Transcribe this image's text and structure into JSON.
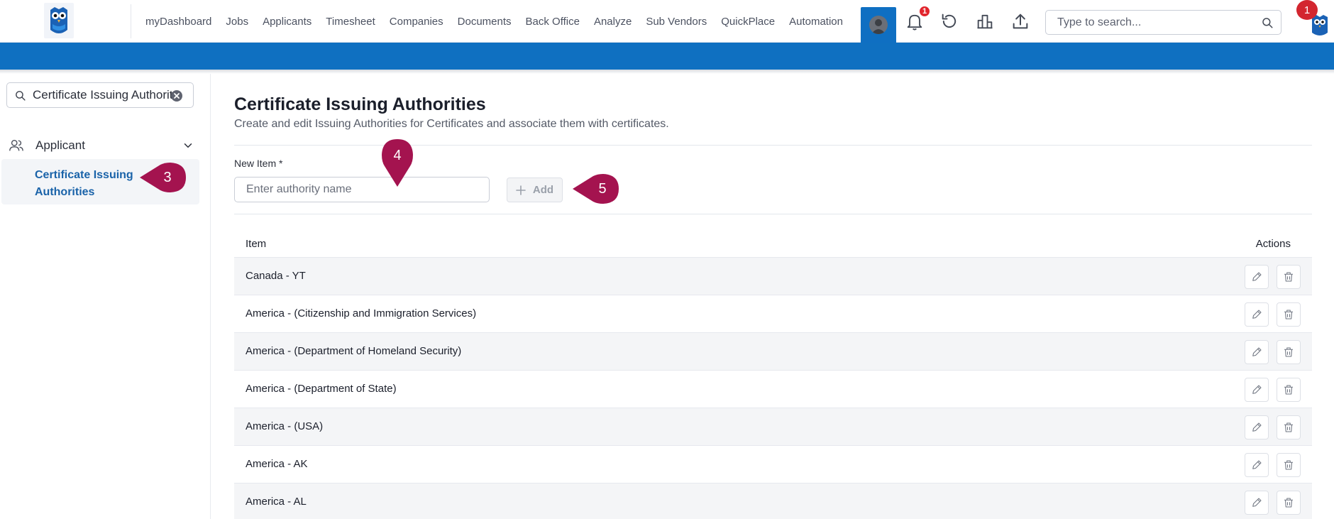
{
  "nav": {
    "items": [
      "myDashboard",
      "Jobs",
      "Applicants",
      "Timesheet",
      "Companies",
      "Documents",
      "Back Office",
      "Analyze",
      "Sub Vendors",
      "QuickPlace",
      "Automation"
    ]
  },
  "header": {
    "notification_count": "1",
    "search_placeholder": "Type to search...",
    "tour_step": "1"
  },
  "sidebar": {
    "search_value": "Certificate Issuing Authorities",
    "group_label": "Applicant",
    "item_label": "Certificate Issuing Authorities",
    "tour_step": "3"
  },
  "main": {
    "title": "Certificate Issuing Authorities",
    "subtitle": "Create and edit Issuing Authorities for Certificates and associate them with certificates.",
    "new_item_label": "New Item *",
    "new_item_placeholder": "Enter authority name",
    "add_label": "Add",
    "input_tour_step": "4",
    "add_tour_step": "5"
  },
  "table": {
    "columns": [
      "Item",
      "Actions"
    ],
    "rows": [
      "Canada - YT",
      "America - (Citizenship and Immigration Services)",
      "America - (Department of Homeland Security)",
      "America - (Department of State)",
      "America - (USA)",
      "America - AK",
      "America - AL"
    ]
  },
  "colors": {
    "brand_blue": "#0f70c1",
    "link_blue": "#1a63a9",
    "marker": "#a4134f",
    "badge_red": "#e1252d"
  }
}
